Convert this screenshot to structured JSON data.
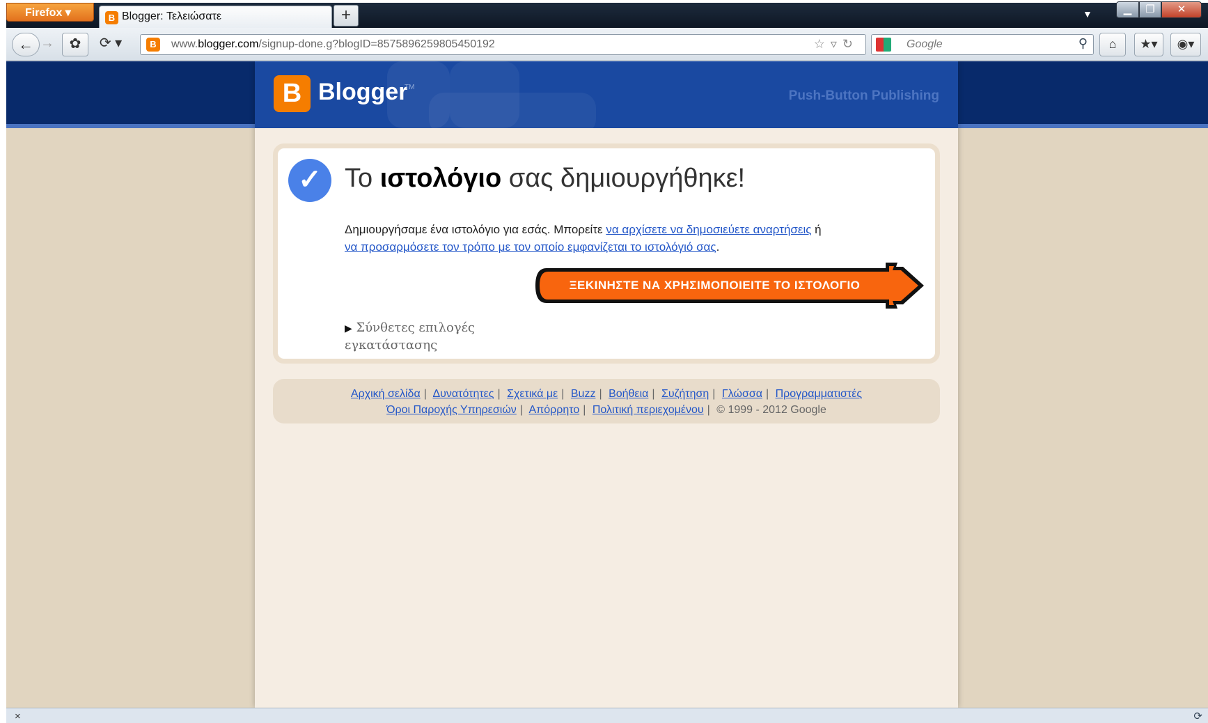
{
  "browser": {
    "menu_label": "Firefox",
    "tab_title": "Blogger: Τελειώσατε",
    "new_tab": "+",
    "url_prefix": "www.",
    "url_host": "blogger.com",
    "url_path": "/signup-done.g?blogID=8575896259805450192",
    "search_placeholder": "Google",
    "status_close": "×"
  },
  "header": {
    "logo_letter": "B",
    "logo_text": "Blogger",
    "logo_tm": "TM",
    "tagline": "Push-Button Publishing"
  },
  "success": {
    "title_before": "Το ",
    "title_bold": "ιστολόγιο",
    "title_after": " σας δημιουργήθηκε!",
    "desc_text": "Δημιουργήσαμε ένα ιστολόγιο για εσάς. Μπορείτε ",
    "link_posts": "να αρχίσετε να δημοσιεύετε αναρτήσεις",
    "desc_or": " ή ",
    "link_customize": "να προσαρμόσετε τον τρόπο με τον οποίο εμφανίζεται το ιστολόγιό σας",
    "desc_end": ".",
    "cta_label": "ΞΕΚΙΝΗΣΤΕ ΝΑ ΧΡΗΣΙΜΟΠΟΙΕΙΤΕ ΤΟ ΙΣΤΟΛΟΓΙΟ",
    "advanced_label": "Σύνθετες επιλογές εγκατάστασης"
  },
  "footer": {
    "row1": [
      "Αρχική σελίδα",
      "Δυνατότητες",
      "Σχετικά με",
      "Buzz",
      "Βοήθεια",
      "Συζήτηση",
      "Γλώσσα",
      "Προγραμματιστές"
    ],
    "row2": [
      "Όροι Παροχής Υπηρεσιών",
      "Απόρρητο",
      "Πολιτική περιεχομένου"
    ],
    "copyright": "© 1999 - 2012 Google"
  },
  "colors": {
    "accent_orange": "#f57d00",
    "header_blue": "#1a49a1",
    "link_blue": "#2256c8",
    "page_beige": "#f5ede3"
  }
}
